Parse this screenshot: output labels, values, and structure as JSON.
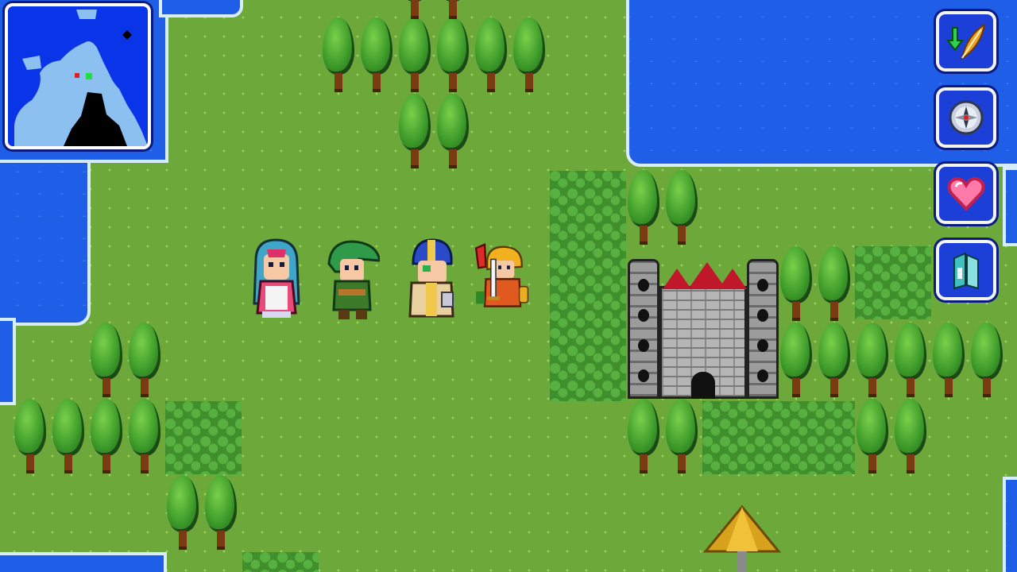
{
  "scene": {
    "type": "overworld-map",
    "palette": {
      "grass": "#6da83a",
      "water": "#1f5ee6",
      "shore": "#d8ecff",
      "ui_panel": "#1c3fd8",
      "ui_border": "#f4f4f4"
    }
  },
  "party": [
    {
      "name": "",
      "icon": "blue-haired-mage-sprite"
    },
    {
      "name": "",
      "icon": "green-hooded-ranger-sprite"
    },
    {
      "name": "",
      "icon": "blue-helmet-cleric-sprite"
    },
    {
      "name": "",
      "icon": "red-plumed-swordsman-sprite"
    }
  ],
  "landmarks": {
    "castle": {
      "icon": "stone-castle-sprite"
    },
    "tent": {
      "icon": "straw-hut-sprite"
    }
  },
  "minimap": {
    "icon": "world-minimap",
    "markers": [
      "player-marker",
      "destination-marker"
    ]
  },
  "menu": [
    {
      "id": "save",
      "icon": "quill-save-icon"
    },
    {
      "id": "navigate",
      "icon": "compass-icon"
    },
    {
      "id": "status",
      "icon": "heart-icon"
    },
    {
      "id": "book",
      "icon": "book-icon"
    }
  ]
}
